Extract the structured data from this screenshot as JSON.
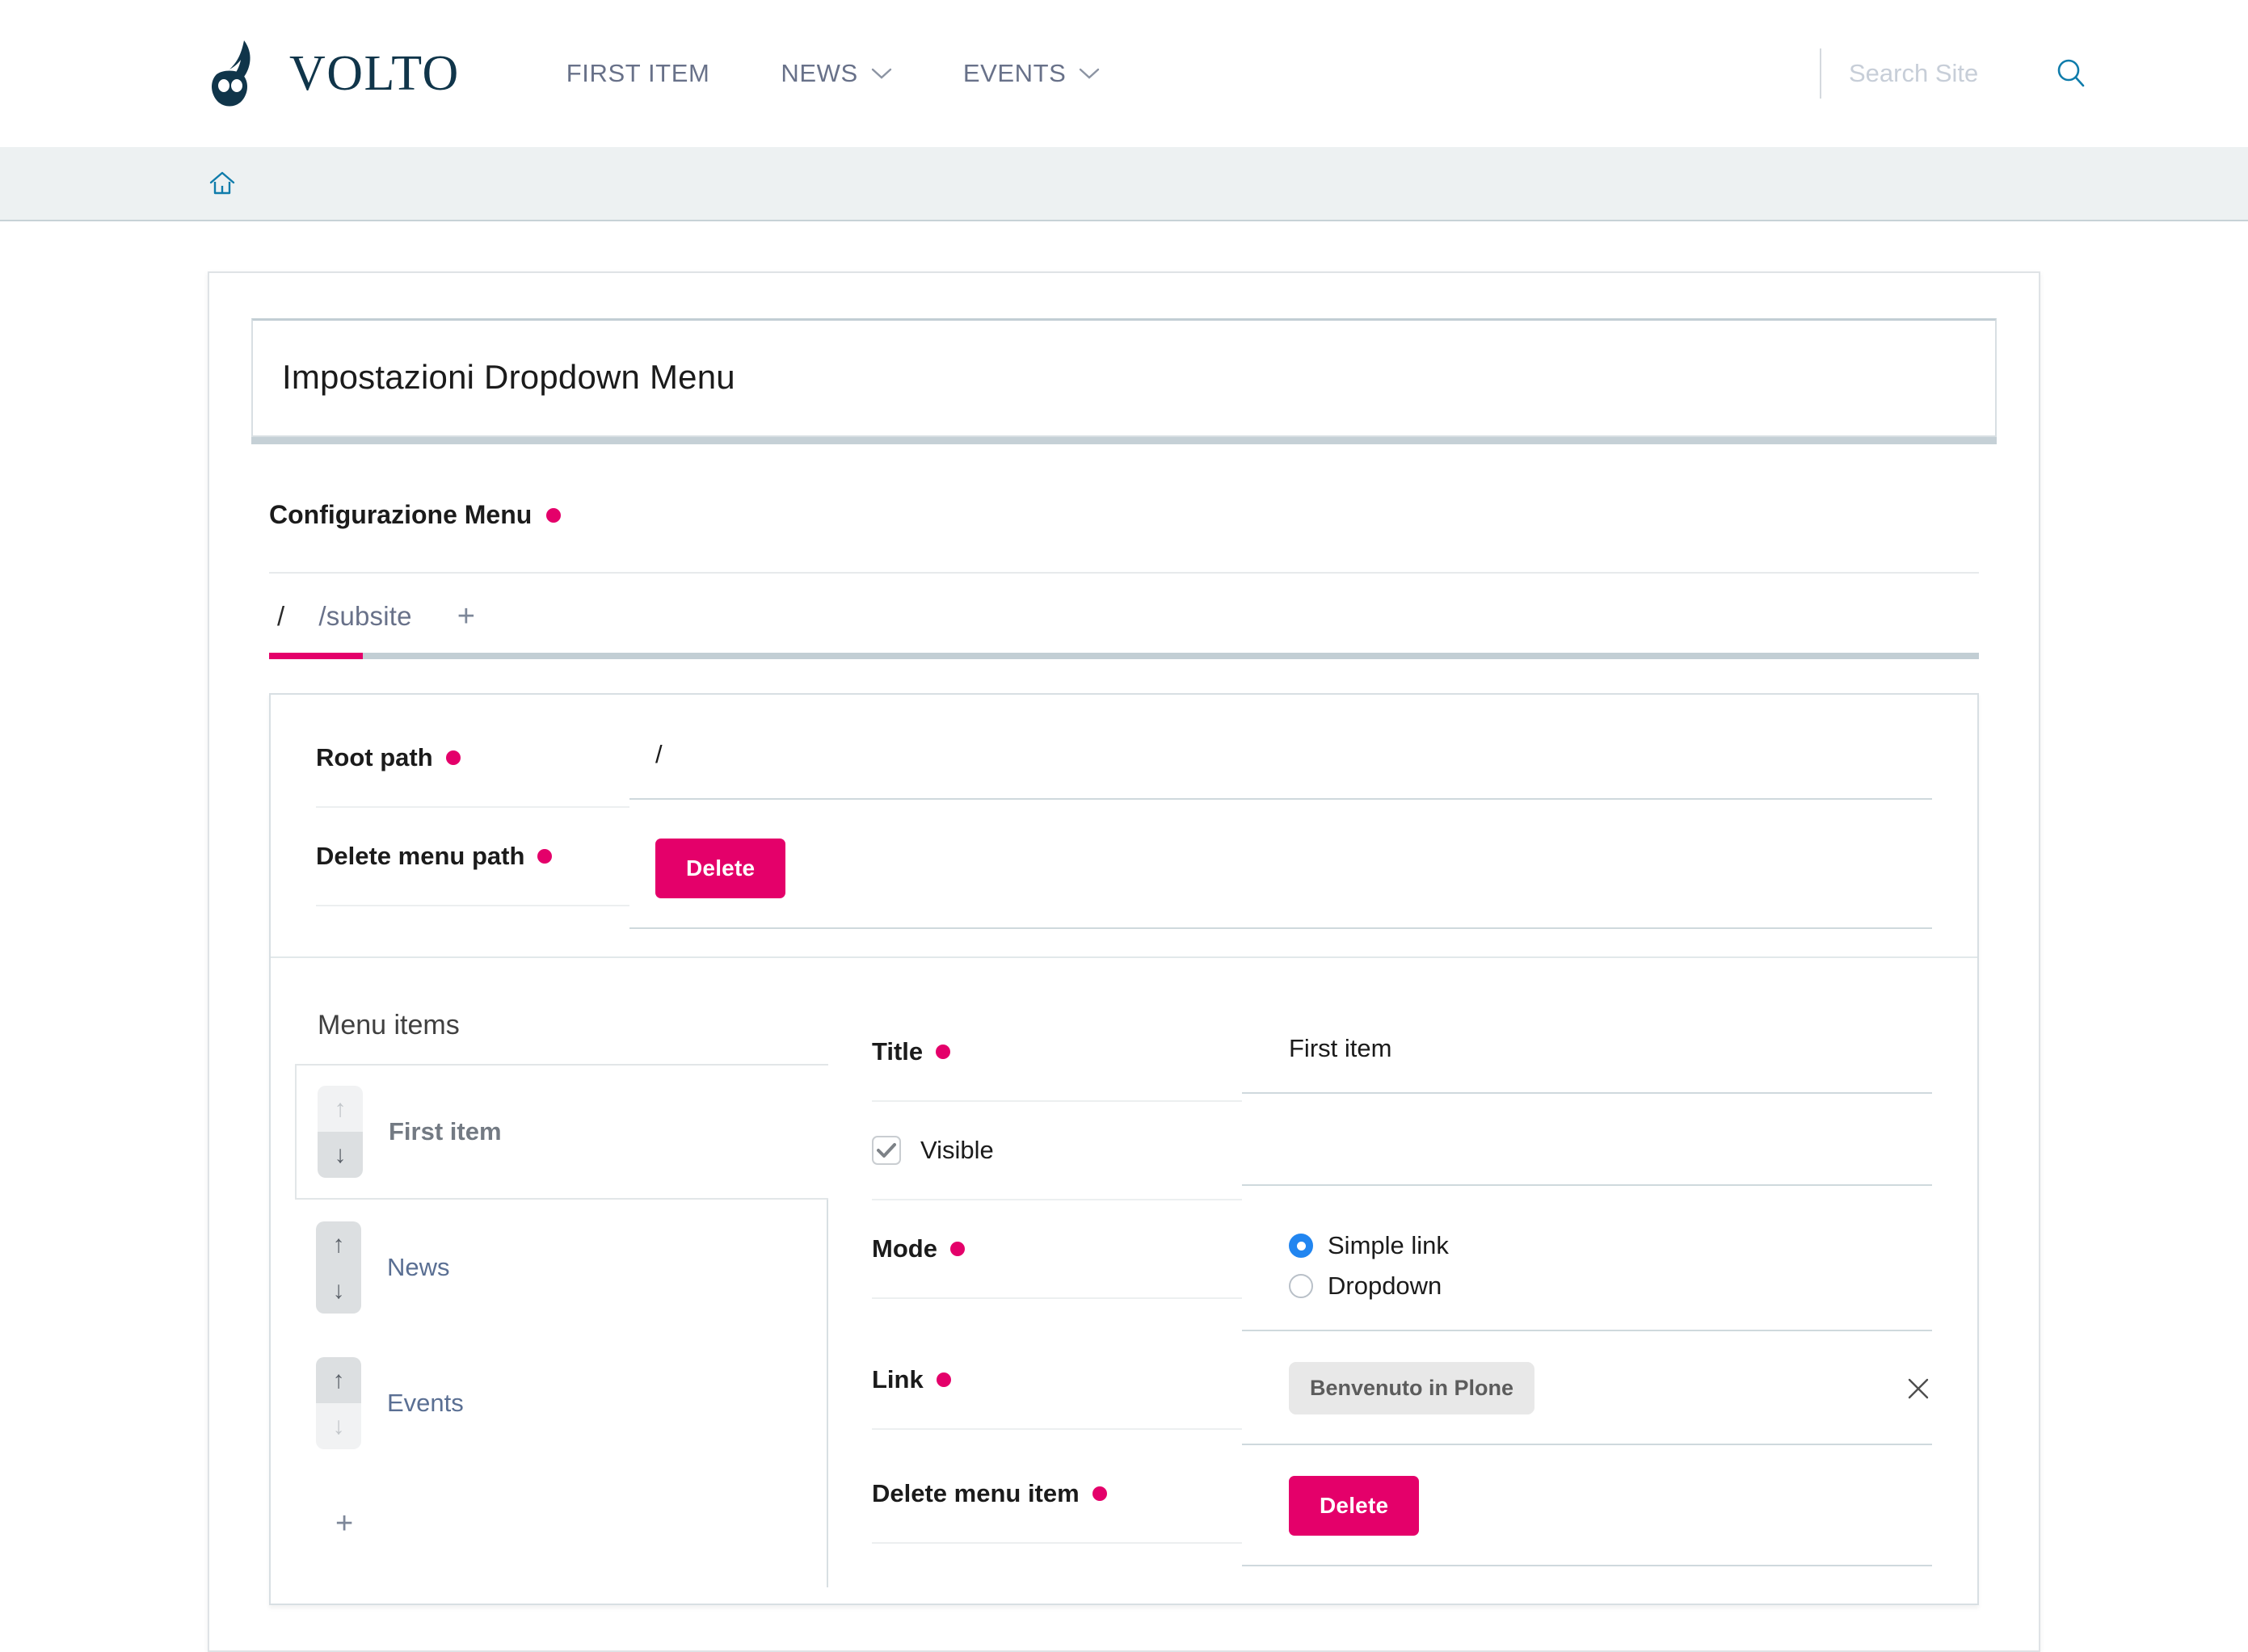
{
  "header": {
    "brand_name": "VOLTO",
    "logo_icon": "volto-flame-logo",
    "nav": [
      {
        "label": "FIRST ITEM",
        "has_dropdown": false
      },
      {
        "label": "NEWS",
        "has_dropdown": true
      },
      {
        "label": "EVENTS",
        "has_dropdown": true
      }
    ],
    "search": {
      "placeholder": "Search Site",
      "value": "",
      "icon": "search-icon"
    }
  },
  "breadcrumb": {
    "home_icon": "home-icon"
  },
  "page": {
    "title": "Impostazioni Dropdown Menu"
  },
  "config_section": {
    "heading": "Configurazione Menu",
    "required": true
  },
  "tabs": {
    "items": [
      {
        "label": "/",
        "active": true
      },
      {
        "label": "/subsite",
        "active": false
      }
    ],
    "add_label": "+",
    "add_icon": "plus-icon"
  },
  "root_fields": [
    {
      "label": "Root path",
      "required": true,
      "type": "text",
      "value": "/"
    },
    {
      "label": "Delete menu path",
      "required": true,
      "type": "button",
      "button_label": "Delete"
    }
  ],
  "menu_items_panel": {
    "title": "Menu items",
    "items": [
      {
        "label": "First item",
        "active": true,
        "up_enabled": false,
        "down_enabled": true
      },
      {
        "label": "News",
        "active": false,
        "up_enabled": true,
        "down_enabled": true
      },
      {
        "label": "Events",
        "active": false,
        "up_enabled": true,
        "down_enabled": false
      }
    ],
    "add_label": "+",
    "add_icon": "plus-icon",
    "up_icon": "arrow-up-icon",
    "down_icon": "arrow-down-icon"
  },
  "detail_form": {
    "title_field": {
      "label": "Title",
      "required": true,
      "value": "First  item"
    },
    "visible_field": {
      "label": "Visible",
      "checked": true,
      "icon": "checkmark-icon"
    },
    "mode_field": {
      "label": "Mode",
      "required": true,
      "options": [
        {
          "label": "Simple link",
          "selected": true
        },
        {
          "label": "Dropdown",
          "selected": false
        }
      ]
    },
    "link_field": {
      "label": "Link",
      "required": true,
      "chip_label": "Benvenuto in Plone",
      "remove_icon": "close-icon"
    },
    "delete_field": {
      "label": "Delete menu item",
      "required": true,
      "button_label": "Delete"
    }
  },
  "colors": {
    "accent_pink": "#e4006a",
    "brand_dark": "#10354a",
    "link_blue": "#5a6f93",
    "radio_blue": "#2185f0",
    "search_icon_blue": "#0f7cab"
  }
}
